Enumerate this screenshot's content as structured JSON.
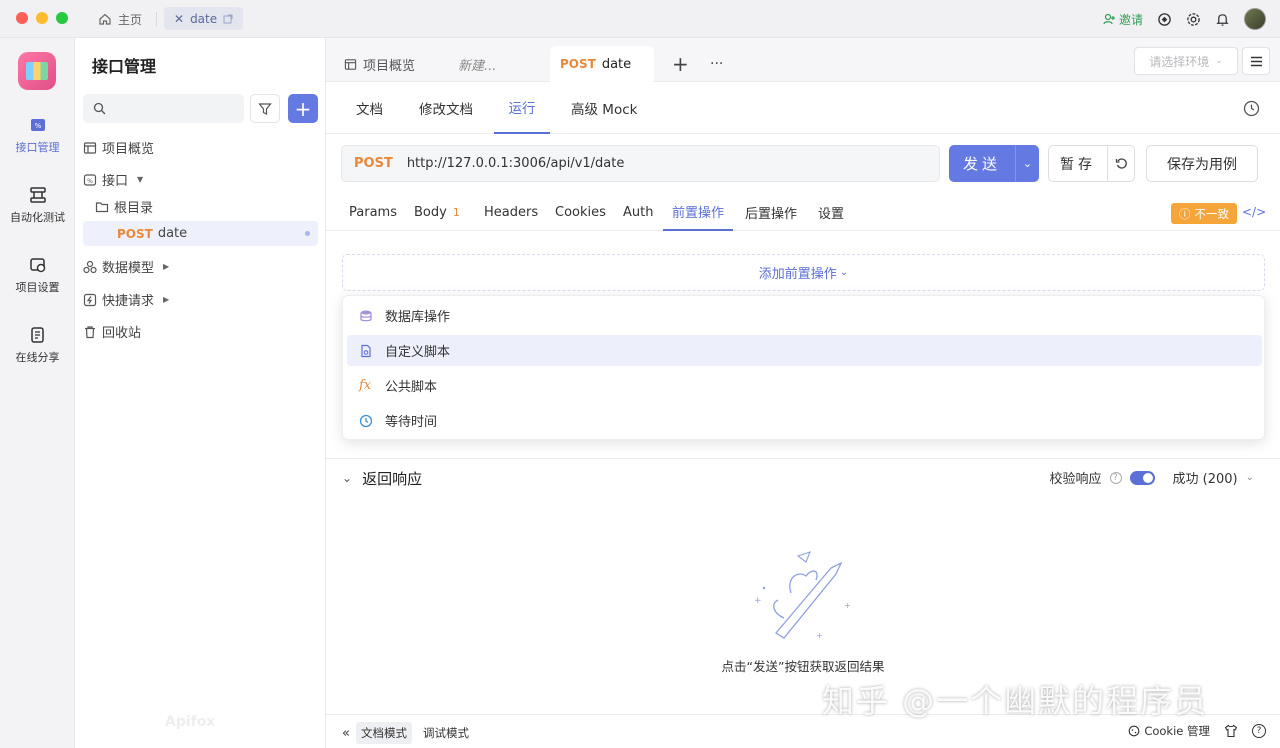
{
  "titlebar": {
    "home_label": "主页",
    "doc_tab_label": "date",
    "invite_label": "邀请"
  },
  "rail": {
    "items": [
      {
        "label": "接口管理"
      },
      {
        "label": "自动化测试"
      },
      {
        "label": "项目设置"
      },
      {
        "label": "在线分享"
      }
    ]
  },
  "sidebar": {
    "title": "接口管理",
    "tree": {
      "overview": "项目概览",
      "api": "接口",
      "root": "根目录",
      "post_method": "POST",
      "post_name": "date",
      "models": "数据模型",
      "quick": "快捷请求",
      "trash": "回收站"
    },
    "watermark": "Apifox"
  },
  "main": {
    "tabs": {
      "overview": "项目概览",
      "new": "新建...",
      "post_method": "POST",
      "post_name": "date"
    },
    "env_placeholder": "请选择环境",
    "subtabs": [
      "文档",
      "修改文档",
      "运行",
      "高级 Mock"
    ],
    "request": {
      "method": "POST",
      "url": "http://127.0.0.1:3006/api/v1/date",
      "send": "发送",
      "save_tmp": "暂存",
      "save_case": "保存为用例"
    },
    "reqtabs": {
      "params": "Params",
      "body": "Body",
      "body_count": "1",
      "headers": "Headers",
      "cookies": "Cookies",
      "auth": "Auth",
      "pre": "前置操作",
      "post": "后置操作",
      "settings": "设置"
    },
    "mismatch": "不一致",
    "code": "</>",
    "add_pre": "添加前置操作",
    "dropdown": [
      "数据库操作",
      "自定义脚本",
      "公共脚本",
      "等待时间"
    ],
    "fx_label": "fx",
    "response": {
      "title": "返回响应",
      "validate": "校验响应",
      "status": "成功 (200)",
      "empty_text": "点击“发送”按钮获取返回结果"
    },
    "bottom": {
      "doc_mode": "文档模式",
      "debug_mode": "调试模式",
      "cookie": "Cookie 管理"
    }
  },
  "watermark_overlay": "知乎 @一个幽默的程序员",
  "colors": {
    "accent": "#6479e2",
    "post": "#e8893a",
    "warning": "#f5a53a",
    "invite": "#2f9e57"
  }
}
